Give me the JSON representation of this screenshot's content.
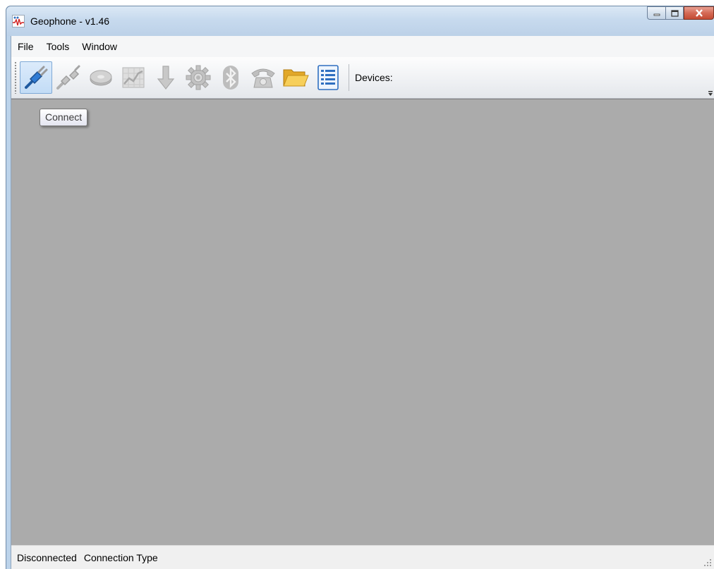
{
  "window": {
    "title": "Geophone - v1.46"
  },
  "menu": {
    "items": [
      {
        "label": "File"
      },
      {
        "label": "Tools"
      },
      {
        "label": "Window"
      }
    ]
  },
  "toolbar": {
    "buttons": [
      {
        "icon": "plug-connect-icon",
        "state": "hover"
      },
      {
        "icon": "plug-disconnect-icon",
        "state": "disabled"
      },
      {
        "icon": "disc-icon",
        "state": "disabled"
      },
      {
        "icon": "chart-icon",
        "state": "disabled"
      },
      {
        "icon": "download-arrow-icon",
        "state": "disabled"
      },
      {
        "icon": "gear-icon",
        "state": "disabled"
      },
      {
        "icon": "bluetooth-icon",
        "state": "disabled"
      },
      {
        "icon": "telephone-icon",
        "state": "disabled"
      },
      {
        "icon": "folder-open-icon",
        "state": "enabled"
      },
      {
        "icon": "list-icon",
        "state": "enabled"
      }
    ],
    "devices_label": "Devices:"
  },
  "tooltip": {
    "text": "Connect"
  },
  "status": {
    "connection_state": "Disconnected",
    "connection_type": "Connection Type"
  },
  "colors": {
    "workspace": "#ababab",
    "titlebar": "#c7daee",
    "close_button": "#c9503a"
  }
}
